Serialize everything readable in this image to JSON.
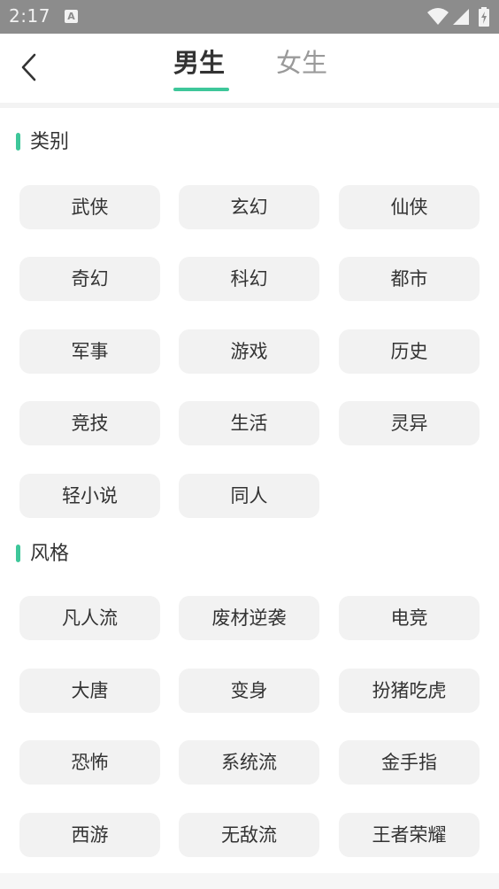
{
  "status_bar": {
    "time": "2:17",
    "notification_icon": "A",
    "icons": [
      "wifi-icon",
      "signal-icon",
      "battery-charging-icon"
    ]
  },
  "header": {
    "back_icon": "chevron-left-icon",
    "tabs": [
      {
        "label": "男生",
        "active": true
      },
      {
        "label": "女生",
        "active": false
      }
    ]
  },
  "sections": [
    {
      "title": "类别",
      "items": [
        "武侠",
        "玄幻",
        "仙侠",
        "奇幻",
        "科幻",
        "都市",
        "军事",
        "游戏",
        "历史",
        "竞技",
        "生活",
        "灵异",
        "轻小说",
        "同人"
      ]
    },
    {
      "title": "风格",
      "items": [
        "凡人流",
        "废材逆袭",
        "电竞",
        "大唐",
        "变身",
        "扮猪吃虎",
        "恐怖",
        "系统流",
        "金手指",
        "西游",
        "无敌流",
        "王者荣耀"
      ]
    }
  ],
  "colors": {
    "accent": "#3ec79a",
    "chip_bg": "#f2f2f2",
    "status_bar": "#8c8c8c"
  }
}
